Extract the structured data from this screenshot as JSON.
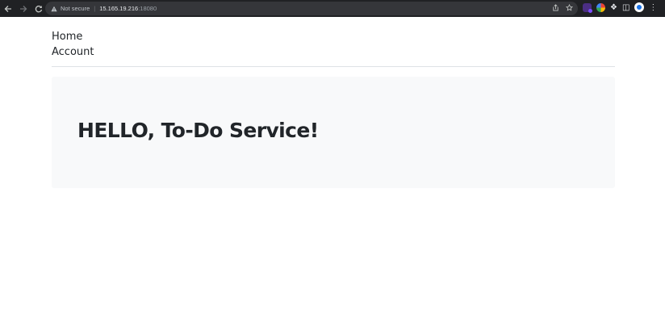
{
  "browser": {
    "security_label": "Not secure",
    "url_host": "15.165.19.216",
    "url_port": ":18080",
    "icons": [
      "back-arrow-icon",
      "forward-arrow-icon",
      "reload-icon",
      "warning-triangle-icon",
      "share-icon",
      "star-icon",
      "extension-icon",
      "color-wheel-icon",
      "puzzle-icon",
      "side-panel-icon",
      "profile-icon",
      "menu-dots-icon"
    ]
  },
  "nav": {
    "items": [
      {
        "label": "Home"
      },
      {
        "label": "Account"
      }
    ]
  },
  "hero": {
    "title": "HELLO, To-Do Service!"
  },
  "colors": {
    "chrome_bg": "#202124",
    "hero_bg": "#f8f9fa",
    "text": "#212529",
    "divider": "#dee2e6"
  }
}
